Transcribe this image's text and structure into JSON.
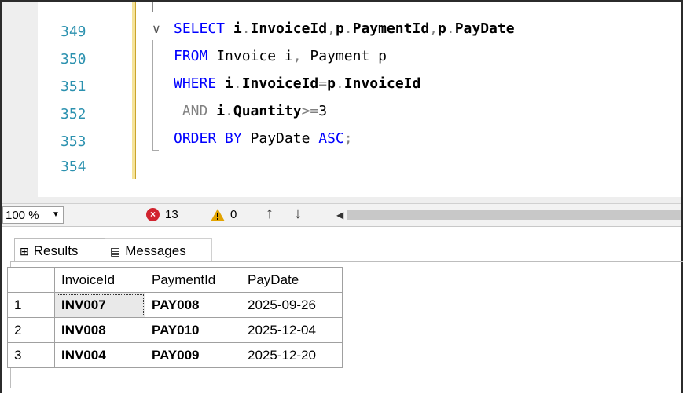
{
  "editor": {
    "line_numbers": [
      "349",
      "350",
      "351",
      "352",
      "353",
      "354"
    ],
    "code_lines": [
      {
        "parts": [
          {
            "t": "SELECT ",
            "c": "kw"
          },
          {
            "t": "i",
            "c": "id"
          },
          {
            "t": ".",
            "c": "gr"
          },
          {
            "t": "InvoiceId",
            "c": "id"
          },
          {
            "t": ",",
            "c": "gr"
          },
          {
            "t": "p",
            "c": "id"
          },
          {
            "t": ".",
            "c": "gr"
          },
          {
            "t": "PaymentId",
            "c": "id"
          },
          {
            "t": ",",
            "c": "gr"
          },
          {
            "t": "p",
            "c": "id"
          },
          {
            "t": ".",
            "c": "gr"
          },
          {
            "t": "PayDate",
            "c": "id"
          }
        ]
      },
      {
        "parts": [
          {
            "t": "FROM ",
            "c": "kw"
          },
          {
            "t": "Invoice i",
            "c": ""
          },
          {
            "t": ", ",
            "c": "gr"
          },
          {
            "t": "Payment p",
            "c": ""
          }
        ]
      },
      {
        "parts": [
          {
            "t": "WHERE ",
            "c": "kw"
          },
          {
            "t": "i",
            "c": "id"
          },
          {
            "t": ".",
            "c": "gr"
          },
          {
            "t": "InvoiceId",
            "c": "id"
          },
          {
            "t": "=",
            "c": "gr"
          },
          {
            "t": "p",
            "c": "id"
          },
          {
            "t": ".",
            "c": "gr"
          },
          {
            "t": "InvoiceId",
            "c": "id"
          }
        ]
      },
      {
        "parts": [
          {
            "t": " AND ",
            "c": "gr"
          },
          {
            "t": "i",
            "c": "id"
          },
          {
            "t": ".",
            "c": "gr"
          },
          {
            "t": "Quantity",
            "c": "id"
          },
          {
            "t": ">=",
            "c": "gr"
          },
          {
            "t": "3",
            "c": ""
          }
        ]
      },
      {
        "parts": [
          {
            "t": "ORDER BY ",
            "c": "kw"
          },
          {
            "t": "PayDate ",
            "c": ""
          },
          {
            "t": "ASC",
            "c": "kw"
          },
          {
            "t": ";",
            "c": "gr"
          }
        ]
      },
      {
        "parts": []
      }
    ],
    "fold_glyph": "∨"
  },
  "toolbar": {
    "zoom_value": "100 %",
    "errors_count": "13",
    "warnings_count": "0",
    "error_icon_glyph": "×",
    "up_glyph": "↑",
    "down_glyph": "↓"
  },
  "tabs": {
    "results_label": "Results",
    "messages_label": "Messages"
  },
  "grid": {
    "columns": [
      "InvoiceId",
      "PaymentId",
      "PayDate"
    ],
    "rows": [
      {
        "num": "1",
        "cells": [
          "INV007",
          "PAY008",
          "2025-09-26"
        ]
      },
      {
        "num": "2",
        "cells": [
          "INV008",
          "PAY010",
          "2025-12-04"
        ]
      },
      {
        "num": "3",
        "cells": [
          "INV004",
          "PAY009",
          "2025-12-20"
        ]
      }
    ]
  },
  "colors": {
    "keyword": "#0000ff",
    "line_number": "#2b91af",
    "error": "#d1242f",
    "warning": "#e2a300"
  }
}
